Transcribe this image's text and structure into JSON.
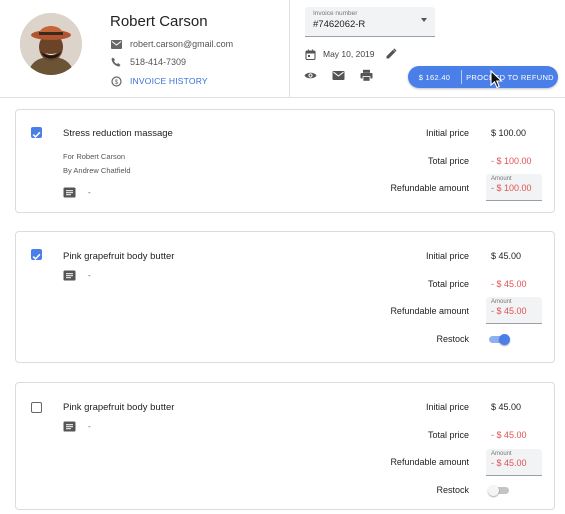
{
  "customer": {
    "name": "Robert Carson",
    "email": "robert.carson@gmail.com",
    "phone": "518-414-7309",
    "history_link": "INVOICE HISTORY"
  },
  "invoice": {
    "select_label": "Invoice number",
    "select_value": "#7462062-R",
    "date": "May 10, 2019"
  },
  "refund_button": {
    "amount": "$ 162.40",
    "label": "PROCEED TO REFUND"
  },
  "icons": [
    "person-icon-avatar",
    "email-icon",
    "phone-icon",
    "history-icon",
    "caret-down-icon",
    "calendar-icon",
    "pencil-icon",
    "eye-icon",
    "mail-icon",
    "printer-icon",
    "note-icon",
    "mouse-cursor-icon"
  ],
  "colors": {
    "accent": "#4a7fea",
    "negative": "#e05252",
    "field_bg": "#f2f3f5",
    "border": "#dcdcdc"
  },
  "labels": {
    "initial_price": "Initial price",
    "total_price": "Total price",
    "refundable_amount": "Refundable amount",
    "amount_field": "Amount",
    "restock": "Restock"
  },
  "items": [
    {
      "checked": true,
      "title": "Stress reduction massage",
      "for_line": "For Robert Carson",
      "by_line": "By Andrew Chatfield",
      "note": "-",
      "initial_price": "$ 100.00",
      "total_price": "- $ 100.00",
      "refundable_amount": "- $ 100.00"
    },
    {
      "checked": true,
      "title": "Pink grapefruit body butter",
      "note": "-",
      "initial_price": "$ 45.00",
      "total_price": "- $ 45.00",
      "refundable_amount": "- $ 45.00",
      "restock": true
    },
    {
      "checked": false,
      "title": "Pink grapefruit body butter",
      "note": "-",
      "initial_price": "$ 45.00",
      "total_price": "- $ 45.00",
      "refundable_amount": "- $ 45.00",
      "restock": false
    }
  ]
}
